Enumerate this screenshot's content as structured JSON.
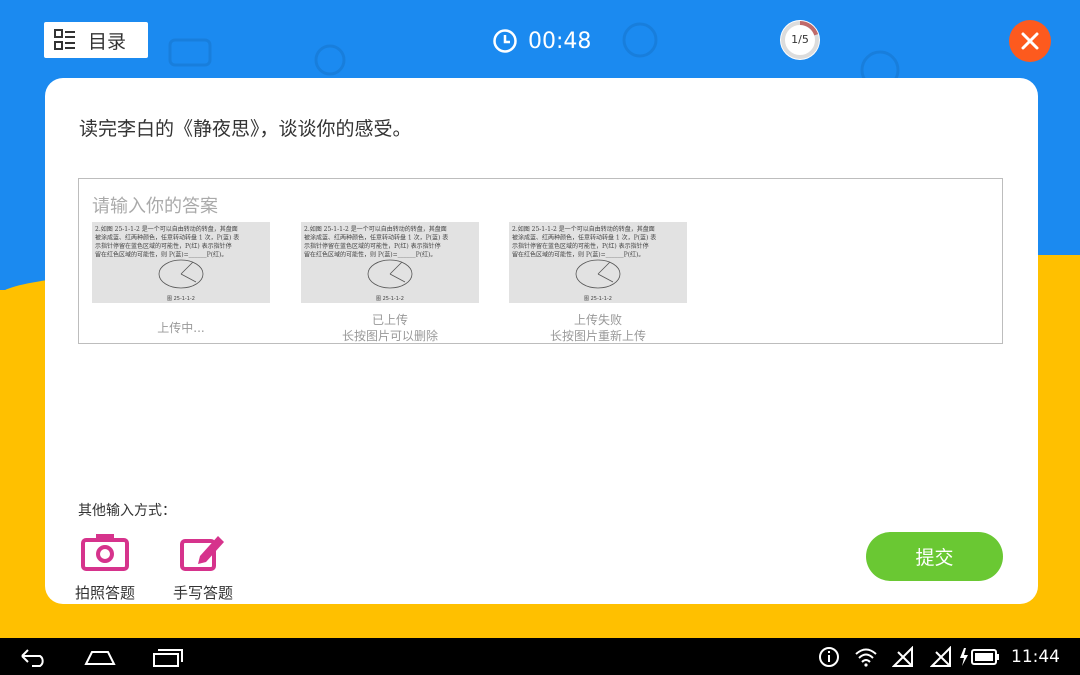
{
  "header": {
    "menu_label": "目录",
    "timer": "00:48",
    "progress": {
      "text": "1/5",
      "fraction": 0.2
    }
  },
  "question": {
    "text": "读完李白的《静夜思》，谈谈你的感受。"
  },
  "answer": {
    "placeholder": "请输入你的答案",
    "images": [
      {
        "status": "上传中...",
        "hint": ""
      },
      {
        "status": "已上传",
        "hint": "长按图片可以删除"
      },
      {
        "status": "上传失败",
        "hint": "长按图片重新上传"
      }
    ],
    "thumbnail_text": {
      "line1": "2.如图 25-1-1-2 是一个可以自由转动的转盘，其盘面",
      "line2": "被涂成蓝、红两种颜色，任意转动转盘 1 次，P(蓝) 表",
      "line3": "示指针停留在蓝色区域的可能性，P(红) 表示指针停",
      "line4": "留在红色区域的可能性，则 P(蓝)=______P(红)。",
      "caption": "图 25-1-1-2"
    }
  },
  "other_input": {
    "label": "其他输入方式：",
    "photo_label": "拍照答题",
    "handwrite_label": "手写答题"
  },
  "submit_label": "提交",
  "status_bar": {
    "time": "11:44"
  },
  "colors": {
    "top_bg": "#1b8af0",
    "bottom_bg": "#ffc000",
    "close": "#fd5a1e",
    "submit": "#6ac833",
    "tool_icon": "#d6338c"
  }
}
